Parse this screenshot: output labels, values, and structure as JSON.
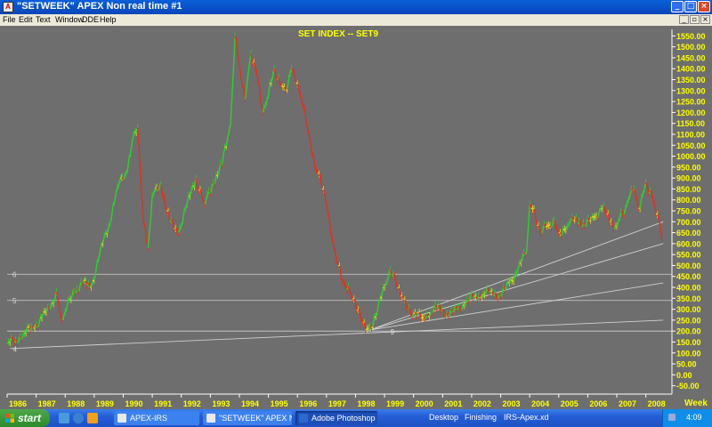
{
  "window": {
    "title": "\"SETWEEK\" APEX Non real time #1",
    "app_icon": "apex-app-icon",
    "controls": [
      "minimize",
      "maximize",
      "close"
    ]
  },
  "menu": {
    "items": [
      "File",
      "Edit",
      "Text",
      "Window",
      "DDE",
      "Help"
    ]
  },
  "chart_data": {
    "type": "line",
    "title": "SET INDEX -- SET9",
    "xlabel": "",
    "ylabel": "",
    "x_axis_unit_label": "Week",
    "x_ticks": [
      "1986",
      "1987",
      "1988",
      "1989",
      "1990",
      "1991",
      "1992",
      "1993",
      "1994",
      "1995",
      "1996",
      "1997",
      "1998",
      "1999",
      "2000",
      "2001",
      "2002",
      "2003",
      "2004",
      "2005",
      "2006",
      "2007",
      "2008"
    ],
    "y_ticks": [
      "1550.00",
      "1500.00",
      "1450.00",
      "1400.00",
      "1350.00",
      "1300.00",
      "1250.00",
      "1200.00",
      "1150.00",
      "1100.00",
      "1050.00",
      "1000.00",
      "950.00",
      "900.00",
      "850.00",
      "800.00",
      "750.00",
      "700.00",
      "650.00",
      "600.00",
      "550.00",
      "500.00",
      "450.00",
      "400.00",
      "350.00",
      "300.00",
      "250.00",
      "200.00",
      "150.00",
      "100.00",
      "50.00",
      "0.00",
      "-50.00"
    ],
    "xlim": [
      1986,
      2008.9
    ],
    "ylim": [
      -80,
      1580
    ],
    "grid": false,
    "price_series": {
      "name": "",
      "x": [
        1986.0,
        1986.3,
        1986.6,
        1986.9,
        1987.2,
        1987.5,
        1987.7,
        1987.85,
        1988.0,
        1988.3,
        1988.6,
        1988.9,
        1989.2,
        1989.5,
        1989.8,
        1990.1,
        1990.3,
        1990.5,
        1990.7,
        1990.85,
        1991.0,
        1991.3,
        1991.6,
        1991.9,
        1992.2,
        1992.5,
        1992.8,
        1993.1,
        1993.4,
        1993.7,
        1993.85,
        1994.0,
        1994.2,
        1994.4,
        1994.6,
        1994.8,
        1995.0,
        1995.2,
        1995.4,
        1995.6,
        1995.8,
        1996.0,
        1996.2,
        1996.4,
        1996.6,
        1996.8,
        1997.0,
        1997.2,
        1997.4,
        1997.6,
        1997.8,
        1998.0,
        1998.2,
        1998.4,
        1998.6,
        1998.8,
        1999.0,
        1999.2,
        1999.4,
        1999.6,
        1999.8,
        2000.0,
        2000.3,
        2000.6,
        2000.9,
        2001.2,
        2001.5,
        2001.8,
        2002.1,
        2002.4,
        2002.7,
        2003.0,
        2003.3,
        2003.6,
        2003.9,
        2004.0,
        2004.2,
        2004.4,
        2004.6,
        2004.8,
        2005.0,
        2005.3,
        2005.6,
        2005.9,
        2006.2,
        2006.5,
        2006.8,
        2007.0,
        2007.2,
        2007.4,
        2007.6,
        2007.8,
        2008.0,
        2008.15,
        2008.3,
        2008.45,
        2008.55
      ],
      "y": [
        140,
        160,
        190,
        215,
        260,
        310,
        380,
        260,
        290,
        380,
        420,
        400,
        560,
        680,
        860,
        920,
        1060,
        1130,
        700,
        580,
        820,
        870,
        700,
        650,
        780,
        900,
        780,
        880,
        960,
        1150,
        1550,
        1420,
        1260,
        1470,
        1380,
        1200,
        1280,
        1400,
        1330,
        1300,
        1400,
        1330,
        1230,
        1100,
        950,
        900,
        780,
        620,
        500,
        420,
        380,
        330,
        250,
        210,
        220,
        330,
        400,
        480,
        420,
        360,
        300,
        280,
        260,
        290,
        310,
        270,
        300,
        330,
        360,
        370,
        380,
        360,
        420,
        480,
        570,
        780,
        720,
        650,
        680,
        700,
        650,
        680,
        720,
        680,
        720,
        760,
        700,
        680,
        740,
        800,
        850,
        760,
        880,
        840,
        780,
        720,
        620
      ],
      "color_up": "#33cc33",
      "color_mid": "#dddd22",
      "color_down": "#dd3322"
    },
    "trendlines": [
      {
        "from": [
          1986.1,
          120
        ],
        "to": [
          2008.6,
          250
        ]
      },
      {
        "from": [
          1998.5,
          205
        ],
        "to": [
          2008.6,
          420
        ]
      },
      {
        "from": [
          1998.5,
          205
        ],
        "to": [
          2008.6,
          600
        ]
      },
      {
        "from": [
          1998.5,
          205
        ],
        "to": [
          2008.6,
          700
        ]
      }
    ],
    "horizontal_levels": [
      {
        "value": 460,
        "label": "6"
      },
      {
        "value": 340,
        "label": "5"
      },
      {
        "value": 200,
        "label": ""
      }
    ],
    "wave_labels": [
      {
        "x": 1986.2,
        "y": 105,
        "label": "4"
      },
      {
        "x": 1999.2,
        "y": 185,
        "label": "9"
      }
    ],
    "colors": {
      "background": "#6e6e6e",
      "title": "#ffff00",
      "axis_text": "#ffff00",
      "axis_line": "#ffffff",
      "trendline": "#d0d0d0"
    }
  },
  "taskbar": {
    "start_label": "start",
    "quick_launch": [
      "desktop-icon",
      "ie-icon",
      "media-icon"
    ],
    "tasks": [
      {
        "label": "APEX-IRS",
        "icon": "apex-icon"
      },
      {
        "label": "\"SETWEEK\" APEX Non ...",
        "icon": "apex-icon"
      },
      {
        "label": "Adobe Photoshop",
        "icon": "photoshop-icon",
        "active": true
      }
    ],
    "toolbar_links": [
      "Desktop",
      "Finishing",
      "IRS-Apex.xd"
    ],
    "clock": "4:09"
  }
}
